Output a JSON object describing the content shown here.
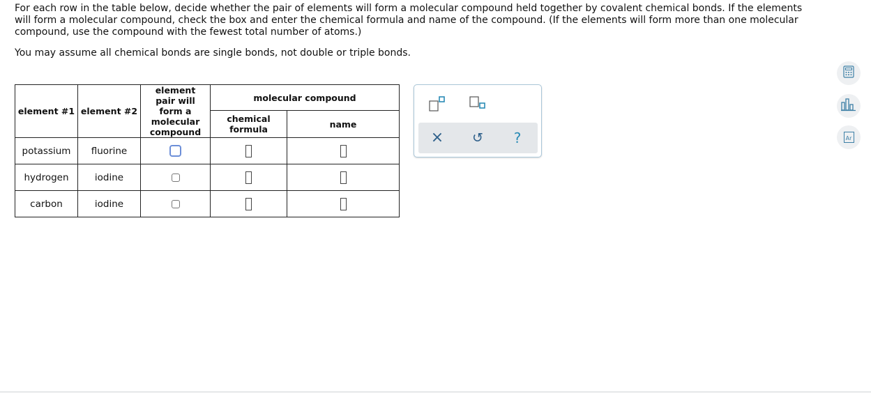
{
  "instructions": {
    "paragraph1": "For each row in the table below, decide whether the pair of elements will form a molecular compound held together by covalent chemical bonds. If the elements will form a molecular compound, check the box and enter the chemical formula and name of the compound. (If the elements will form more than one molecular compound, use the compound with the fewest total number of atoms.)",
    "paragraph2": "You may assume all chemical bonds are single bonds, not double or triple bonds."
  },
  "table": {
    "headers": {
      "element1": "element #1",
      "element2": "element #2",
      "forms": "element pair will form a molecular compound",
      "molecular_compound": "molecular compound",
      "chemical_formula": "chemical formula",
      "name": "name"
    },
    "rows": [
      {
        "element1": "potassium",
        "element2": "fluorine",
        "checked": false,
        "formula": "",
        "name": ""
      },
      {
        "element1": "hydrogen",
        "element2": "iodine",
        "checked": false,
        "formula": "",
        "name": ""
      },
      {
        "element1": "carbon",
        "element2": "iodine",
        "checked": false,
        "formula": "",
        "name": ""
      }
    ]
  },
  "toolpanel": {
    "tools": [
      "superscript-tool-icon",
      "subscript-tool-icon"
    ],
    "actions": {
      "clear": "×",
      "undo": "↺",
      "help": "?"
    }
  },
  "sidebar": {
    "buttons": [
      "calculator-icon",
      "data-chart-icon",
      "periodic-table-icon"
    ],
    "periodic_label": "Ar"
  },
  "colors": {
    "accent": "#2a8bb5",
    "focus": "#6d8fd8",
    "panel_border": "#a9c6d8"
  }
}
